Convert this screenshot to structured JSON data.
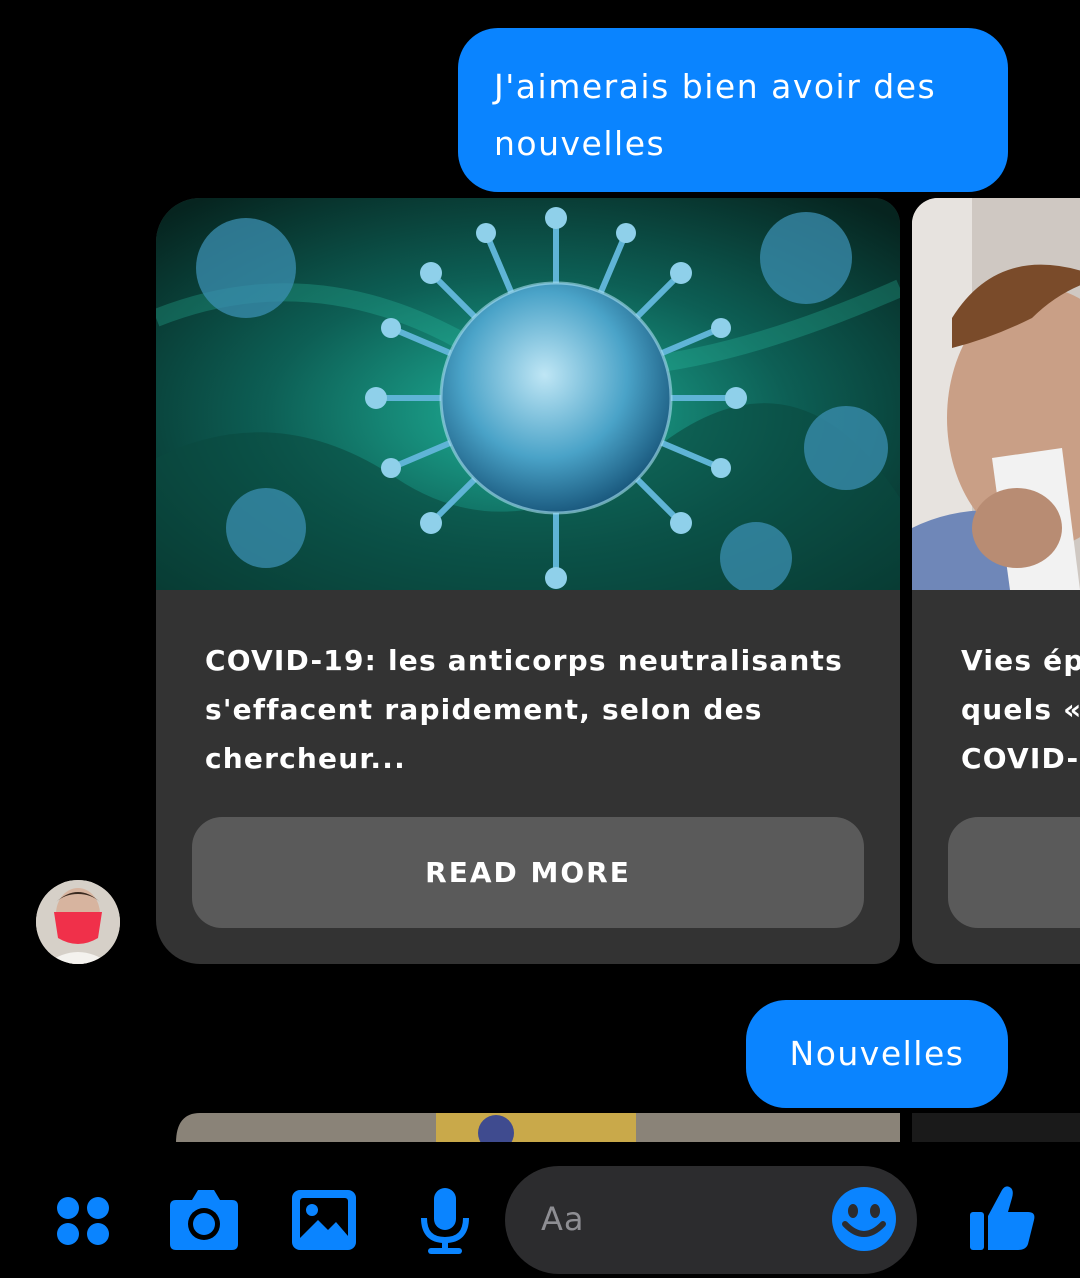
{
  "messages": {
    "sent_1": "J'aimerais bien avoir des nouvelles",
    "sent_2": "Nouvelles"
  },
  "carousel": {
    "cards": [
      {
        "title": "COVID-19: les anticorps neutralisants s'effacent rapidement, selon des chercheur...",
        "button": "READ MORE"
      },
      {
        "title": "Vies ép\nquels «\nCOVID-",
        "button": ""
      }
    ]
  },
  "composer": {
    "placeholder": "Aa",
    "icons": [
      "apps-icon",
      "camera-icon",
      "gallery-icon",
      "microphone-icon",
      "emoji-icon",
      "thumbs-up-icon"
    ],
    "accent": "#0a84ff"
  }
}
